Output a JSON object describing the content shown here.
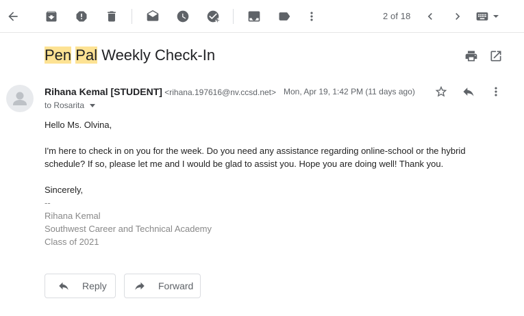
{
  "toolbar": {
    "back": "arrow-back-icon",
    "archive": "archive-icon",
    "spam": "report-spam-icon",
    "delete": "delete-icon",
    "mark_unread": "mark-unread-icon",
    "snooze": "snooze-icon",
    "add_task": "add-to-tasks-icon",
    "move": "move-to-icon",
    "label": "label-icon",
    "more": "more-vert-icon",
    "page_count": "2 of 18"
  },
  "subject": {
    "highlight1": "Pen",
    "highlight2": "Pal",
    "rest": "Weekly Check-In"
  },
  "message": {
    "sender_name": "Rihana Kemal [STUDENT]",
    "sender_email": "<rihana.197616@nv.ccsd.net>",
    "date": "Mon, Apr 19, 1:42 PM (11 days ago)",
    "to_label": "to Rosarita",
    "greeting": "Hello Ms. Olvina,",
    "paragraph": "I'm here to check in on you for the week. Do you need any assistance regarding online-school or the hybrid schedule? If so, please let me and I would be glad to assist you. Hope you are doing well! Thank you.",
    "closing": "Sincerely,",
    "sig_sep": "--",
    "sig_name": "Rihana Kemal",
    "sig_school": "Southwest Career and Technical Academy",
    "sig_class": "Class of 2021"
  },
  "actions": {
    "reply_label": "Reply",
    "forward_label": "Forward"
  },
  "colors": {
    "highlight": "#fde293",
    "icon": "#5f6368"
  }
}
